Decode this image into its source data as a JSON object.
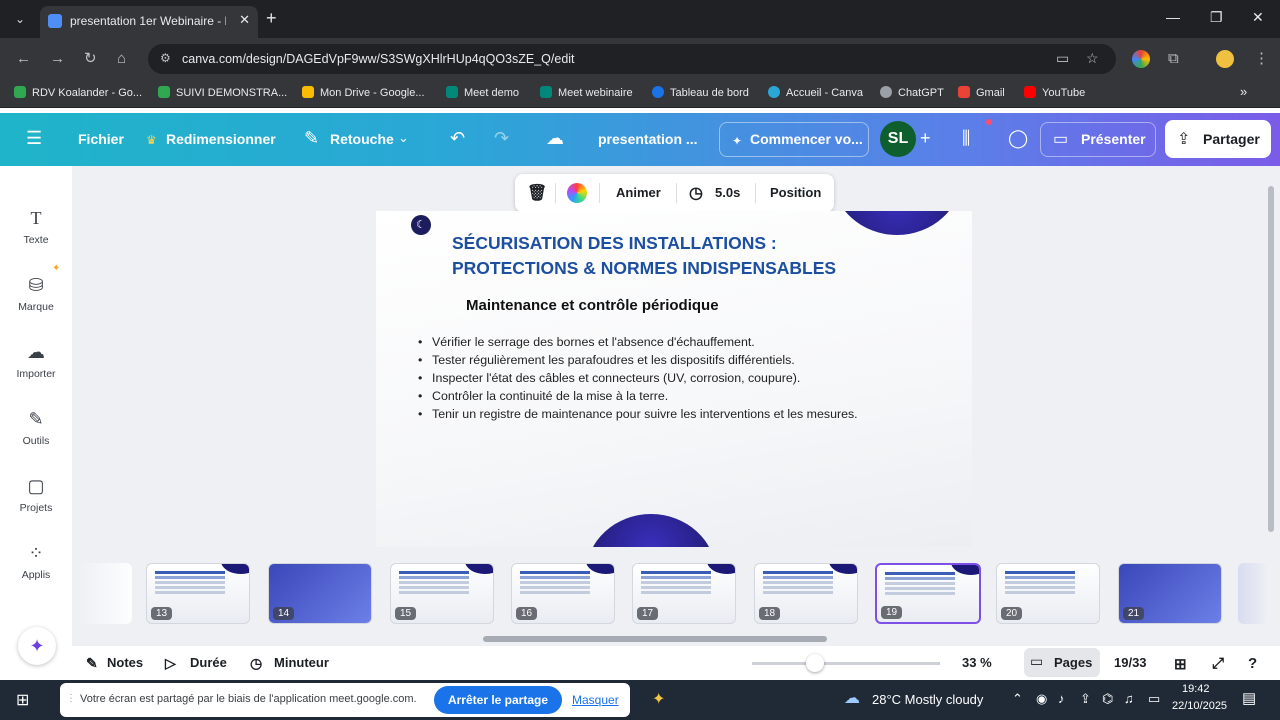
{
  "browser": {
    "tab_title": "presentation 1er Webinaire - P",
    "url": "canva.com/design/DAGEdVpF9ww/S3SWgXHlrHUp4qQO3sZE_Q/edit",
    "bookmarks": [
      "RDV Koalander - Go...",
      "SUIVI DEMONSTRA...",
      "Mon Drive - Google...",
      "Meet demo",
      "Meet webinaire",
      "Tableau de bord",
      "Accueil - Canva",
      "ChatGPT",
      "Gmail",
      "YouTube"
    ]
  },
  "canva": {
    "menu": {
      "file": "Fichier",
      "resize": "Redimensionner",
      "edit": "Retouche",
      "doc_title": "presentation ...",
      "start": "Commencer vo...",
      "avatar": "SL",
      "present": "Présenter",
      "share": "Partager"
    },
    "sidebar": [
      {
        "label": "Texte",
        "icon": "text-icon"
      },
      {
        "label": "Marque",
        "icon": "brand-icon"
      },
      {
        "label": "Importer",
        "icon": "upload-icon"
      },
      {
        "label": "Outils",
        "icon": "tools-icon"
      },
      {
        "label": "Projets",
        "icon": "folder-icon"
      },
      {
        "label": "Applis",
        "icon": "apps-icon"
      }
    ],
    "toolbar": {
      "animate": "Animer",
      "duration": "5.0s",
      "position": "Position"
    },
    "slide": {
      "title_line1": "SÉCURISATION DES INSTALLATIONS :",
      "title_line2": "PROTECTIONS & NORMES INDISPENSABLES",
      "subtitle": "Maintenance et contrôle périodique",
      "bullets": [
        "Vérifier le serrage des bornes et l'absence d'échauffement.",
        "Tester régulièrement les parafoudres et les dispositifs différentiels.",
        "Inspecter l'état des câbles et connecteurs (UV, corrosion, coupure).",
        "Contrôler la continuité de la mise à la terre.",
        "Tenir un registre de maintenance pour suivre les interventions et les mesures."
      ]
    },
    "thumbnails": [
      "13",
      "14",
      "15",
      "16",
      "17",
      "18",
      "19",
      "20",
      "21"
    ],
    "active_page": "19",
    "bottom": {
      "notes": "Notes",
      "duration": "Durée",
      "timer": "Minuteur",
      "zoom": "33 %",
      "zoom_level": 0.33,
      "pages": "Pages",
      "page_count": "19/33"
    }
  },
  "taskbar": {
    "share_text": "Votre écran est partagé par le biais de l'application meet.google.com.",
    "stop_share": "Arrêter le partage",
    "hide": "Masquer",
    "weather": "28°C  Mostly cloudy",
    "time": "19:42",
    "date": "22/10/2025"
  },
  "colors": {
    "canva_gradient_start": "#1fb4c9",
    "canva_gradient_end": "#7a5ce8",
    "slide_title": "#1d4fa0",
    "accent": "#7d4fe6"
  }
}
